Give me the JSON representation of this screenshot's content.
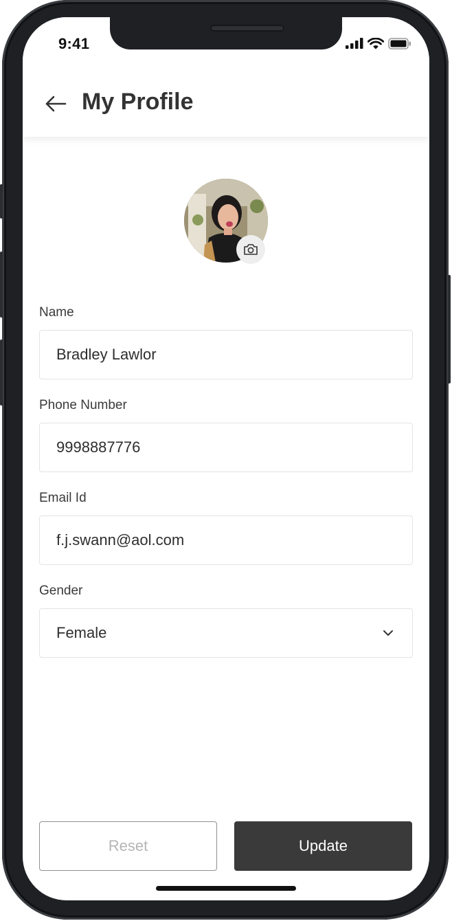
{
  "status_bar": {
    "time": "9:41"
  },
  "header": {
    "title": "My Profile"
  },
  "form": {
    "name_label": "Name",
    "name_value": "Bradley Lawlor",
    "phone_label": "Phone Number",
    "phone_value": "9998887776",
    "email_label": "Email Id",
    "email_value": "f.j.swann@aol.com",
    "gender_label": "Gender",
    "gender_value": "Female"
  },
  "actions": {
    "reset_label": "Reset",
    "update_label": "Update"
  },
  "icons": {
    "back": "arrow-left-icon",
    "camera": "camera-icon",
    "dropdown": "chevron-down-icon",
    "signal": "cellular-signal-icon",
    "wifi": "wifi-icon",
    "battery": "battery-icon"
  },
  "colors": {
    "button_dark": "#3a3a3a",
    "title_text": "#333333",
    "field_border": "#e3e3e3"
  }
}
